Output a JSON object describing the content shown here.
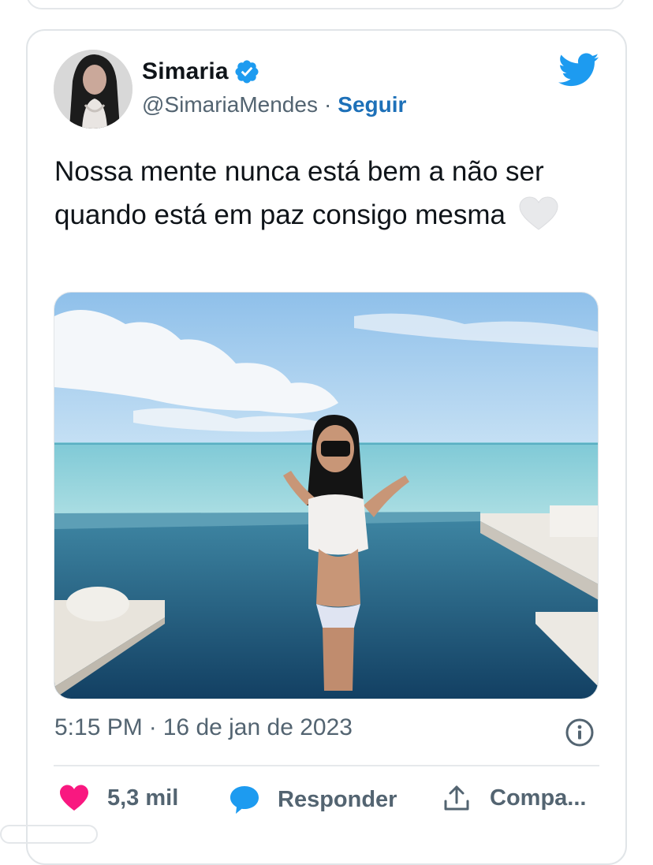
{
  "tweet": {
    "display_name": "Simaria",
    "handle": "@SimariaMendes",
    "separator": "·",
    "follow_label": "Seguir",
    "text": "Nossa mente nunca está bem a não ser quando está em paz consigo mesma",
    "emoji": "white-heart",
    "time": "5:15 PM",
    "date": "16 de jan de 2023"
  },
  "actions": {
    "likes_count": "5,3 mil",
    "reply_label": "Responder",
    "share_label": "Compa..."
  },
  "icons": {
    "verified": "verified-badge-icon",
    "brand": "twitter-bird-icon",
    "info": "info-icon",
    "like": "heart-icon",
    "reply": "speech-bubble-icon",
    "share": "share-upload-icon"
  },
  "colors": {
    "verified": "#1d9bf0",
    "follow": "#1d70b8",
    "like": "#f91880",
    "reply": "#1d9bf0",
    "muted": "#536471"
  }
}
